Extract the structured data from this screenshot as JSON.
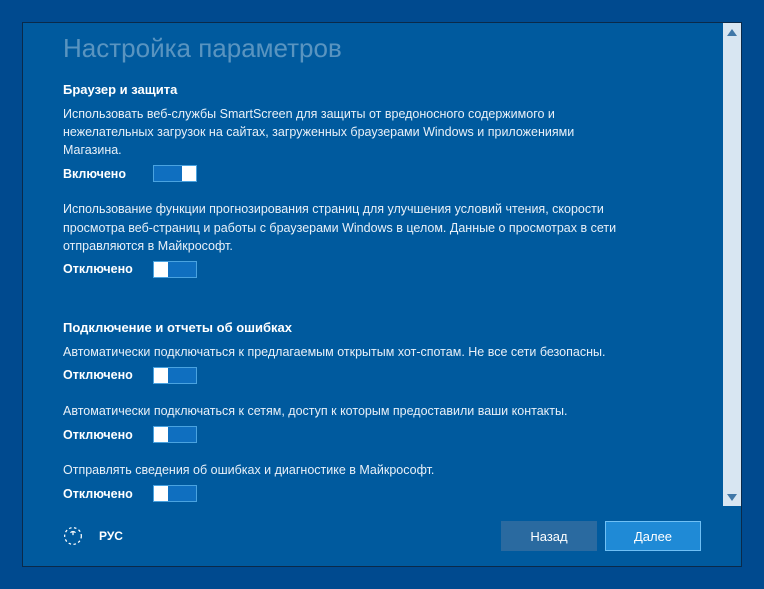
{
  "page": {
    "title": "Настройка параметров"
  },
  "sections": {
    "browser": {
      "header": "Браузер и защита",
      "settings": [
        {
          "desc": "Использовать веб-службы SmartScreen для защиты от вредоносного содержимого и нежелательных загрузок на сайтах, загруженных браузерами Windows и приложениями Магазина.",
          "stateLabel": "Включено",
          "on": true
        },
        {
          "desc": "Использование функции прогнозирования страниц для улучшения условий чтения, скорости просмотра веб-страниц и работы с браузерами Windows в целом. Данные о просмотрах в сети отправляются в Майкрософт.",
          "stateLabel": "Отключено",
          "on": false
        }
      ]
    },
    "connectivity": {
      "header": "Подключение и отчеты об ошибках",
      "settings": [
        {
          "desc": "Автоматически подключаться к предлагаемым открытым хот-спотам. Не все сети безопасны.",
          "stateLabel": "Отключено",
          "on": false
        },
        {
          "desc": "Автоматически подключаться к сетям, доступ к которым предоставили ваши контакты.",
          "stateLabel": "Отключено",
          "on": false
        },
        {
          "desc": "Отправлять сведения об ошибках и диагностике в Майкрософт.",
          "stateLabel": "Отключено",
          "on": false
        }
      ]
    }
  },
  "footer": {
    "lang": "РУС",
    "back": "Назад",
    "next": "Далее"
  }
}
